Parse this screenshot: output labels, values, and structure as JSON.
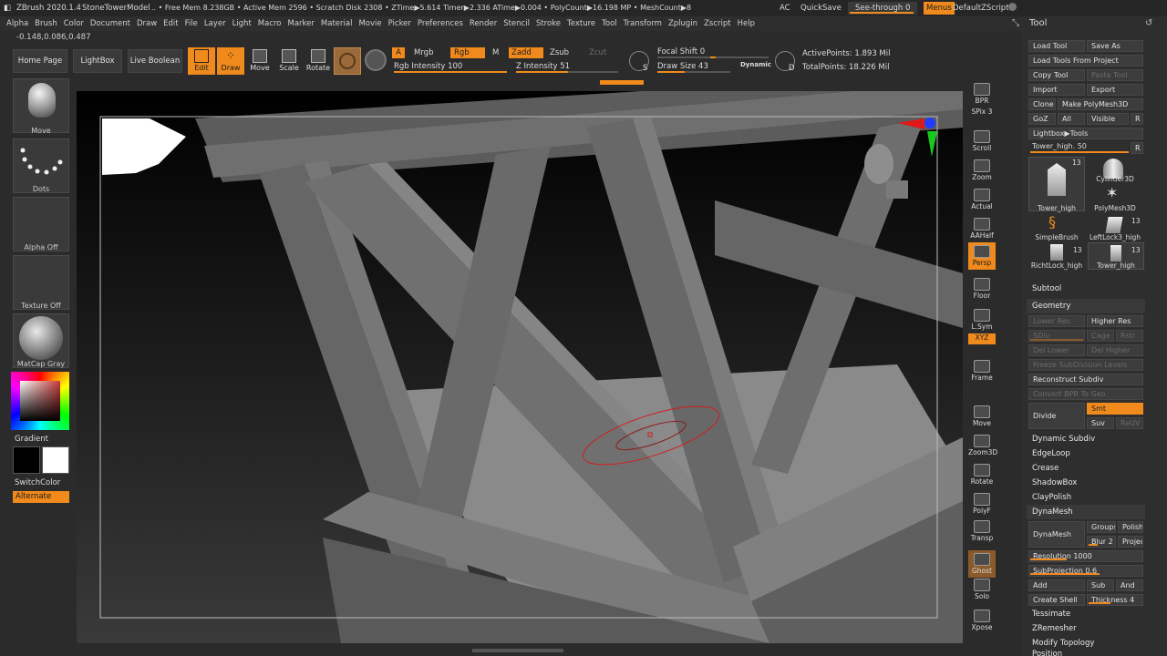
{
  "titlebar": {
    "app": "ZBrush 2020.1.4",
    "project": "StoneTowerModel",
    "stats": ".. • Free Mem 8.238GB • Active Mem 2596 • Scratch Disk 2308 • ZTime▶5.614 Timer▶2.336 ATime▶0.004 • PolyCount▶16.198 MP • MeshCount▶8",
    "ac": "AC",
    "quicksave": "QuickSave",
    "see_through": "See-through  0",
    "menus": "Menus",
    "default_zscript": "DefaultZScript"
  },
  "menubar": [
    "Alpha",
    "Brush",
    "Color",
    "Document",
    "Draw",
    "Edit",
    "File",
    "Layer",
    "Light",
    "Macro",
    "Marker",
    "Material",
    "Movie",
    "Picker",
    "Preferences",
    "Render",
    "Stencil",
    "Stroke",
    "Texture",
    "Tool",
    "Transform",
    "Zplugin",
    "Zscript",
    "Help"
  ],
  "coords": "-0.148,0.086,0.487",
  "shelf": {
    "home_page": "Home Page",
    "lightbox": "LightBox",
    "live_boolean": "Live Boolean",
    "edit": "Edit",
    "draw": "Draw",
    "move": "Move",
    "scale": "Scale",
    "rotate": "Rotate",
    "a": "A",
    "mrgb": "Mrgb",
    "rgb": "Rgb",
    "m": "M",
    "rgb_intensity": "Rgb Intensity 100",
    "zadd": "Zadd",
    "zsub": "Zsub",
    "zcut": "Zcut",
    "z_intensity": "Z Intensity 51",
    "focal_shift": "Focal Shift 0",
    "draw_size": "Draw Size 43",
    "dynamic": "Dynamic",
    "active_points": "ActivePoints: 1.893 Mil",
    "total_points": "TotalPoints: 18.226 Mil",
    "s": "S",
    "d": "D"
  },
  "left_shelf": {
    "brush": "Move",
    "stroke": "Dots",
    "alpha": "Alpha Off",
    "texture": "Texture Off",
    "material": "MatCap Gray",
    "gradient": "Gradient",
    "switch_color": "SwitchColor",
    "alternate": "Alternate"
  },
  "right_shelf": [
    {
      "key": "bpr",
      "label": "BPR"
    },
    {
      "key": "spix",
      "label": "SPix 3"
    },
    {
      "key": "scroll",
      "label": "Scroll"
    },
    {
      "key": "zoom",
      "label": "Zoom"
    },
    {
      "key": "actual",
      "label": "Actual"
    },
    {
      "key": "aahalf",
      "label": "AAHalf"
    },
    {
      "key": "persp",
      "label": "Persp"
    },
    {
      "key": "floor",
      "label": "Floor"
    },
    {
      "key": "lsym",
      "label": "L.Sym"
    },
    {
      "key": "xyz",
      "label": "XYZ"
    },
    {
      "key": "frame",
      "label": "Frame"
    },
    {
      "key": "move",
      "label": "Move"
    },
    {
      "key": "zoom3d",
      "label": "Zoom3D"
    },
    {
      "key": "rotate",
      "label": "Rotate"
    },
    {
      "key": "polyf",
      "label": "PolyF"
    },
    {
      "key": "transp",
      "label": "Transp"
    },
    {
      "key": "ghost",
      "label": "Ghost"
    },
    {
      "key": "solo",
      "label": "Solo"
    },
    {
      "key": "xpose",
      "label": "Xpose"
    }
  ],
  "tool_panel": {
    "title": "Tool",
    "load_tool": "Load Tool",
    "save_as": "Save As",
    "load_from_project": "Load Tools From Project",
    "copy_tool": "Copy Tool",
    "paste_tool": "Paste Tool",
    "import": "Import",
    "export": "Export",
    "clone": "Clone",
    "make_polymesh": "Make PolyMesh3D",
    "goz": "GoZ",
    "all": "All",
    "visible": "Visible",
    "r": "R",
    "lightbox_tools": "Lightbox▶Tools",
    "tower_high_slider": "Tower_high. 50",
    "thumbs": [
      {
        "key": "tower_high",
        "label": "Tower_high",
        "count": "13"
      },
      {
        "key": "cylinder3d",
        "label": "Cylinder3D",
        "count": ""
      },
      {
        "key": "polymesh3d",
        "label": "PolyMesh3D",
        "count": ""
      },
      {
        "key": "simplebrush",
        "label": "SimpleBrush",
        "count": ""
      },
      {
        "key": "leftlock3",
        "label": "LeftLock3_high",
        "count": "13"
      },
      {
        "key": "richtlock",
        "label": "RichtLock_high",
        "count": "13"
      },
      {
        "key": "tower_high2",
        "label": "Tower_high",
        "count": "13"
      }
    ],
    "subtool": "Subtool",
    "geometry": "Geometry",
    "lower_res": "Lower Res",
    "higher_res": "Higher Res",
    "sdiv": "SDiv",
    "cage": "Cage",
    "rstr": "Rstr",
    "del_lower": "Del Lower",
    "del_higher": "Del Higher",
    "freeze": "Freeze SubDivision Levels",
    "reconstruct": "Reconstruct Subdiv",
    "convert_bpr": "Convert BPR To Geo",
    "divide": "Divide",
    "smt": "Smt",
    "suv": "Suv",
    "reuv": "ReUV",
    "dynamic_subdiv": "Dynamic Subdiv",
    "edgeloop": "EdgeLoop",
    "crease": "Crease",
    "shadowbox": "ShadowBox",
    "claypolish": "ClayPolish",
    "dynamesh_section": "DynaMesh",
    "dynamesh_btn": "DynaMesh",
    "groups": "Groups",
    "polish": "Polish",
    "blur": "Blur 2",
    "project": "Project",
    "resolution": "Resolution 1000",
    "subprojection": "SubProjection 0.6",
    "add": "Add",
    "sub": "Sub",
    "and": "And",
    "create_shell": "Create Shell",
    "thickness": "Thickness 4",
    "tessimate": "Tessimate",
    "zremesher": "ZRemesher",
    "modify_topology": "Modify Topology",
    "position": "Position"
  }
}
